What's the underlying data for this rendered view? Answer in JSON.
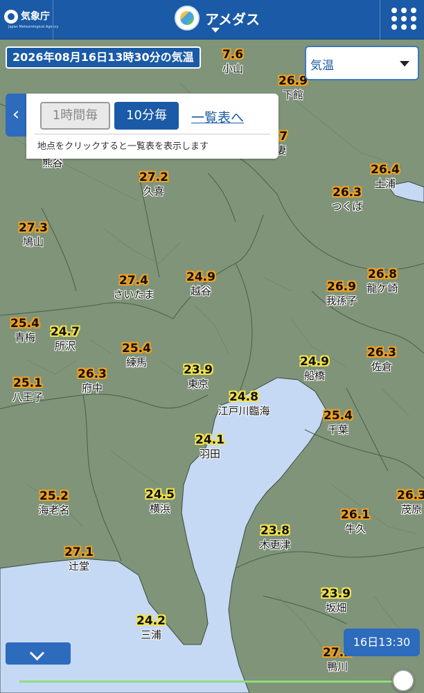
{
  "header": {
    "agency_name": "気象庁",
    "agency_sub": "Japan Meteorological Agency",
    "app_title": "アメダス"
  },
  "datetime_label": "2026年08月16日13時30分の気温",
  "element_select": {
    "value": "気温"
  },
  "panel": {
    "btn_hourly": "1時間毎",
    "btn_10min": "10分毎",
    "list_link": "一覧表へ",
    "hint": "地点をクリックすると一覧表を表示します"
  },
  "stations": [
    {
      "id": "oyama",
      "value": "7.6",
      "name": "小山"
    },
    {
      "id": "shimodate",
      "value": "26.9",
      "name": "下館"
    },
    {
      "id": "koga",
      "value": ".7",
      "name": "妻"
    },
    {
      "id": "kumagaya",
      "value": "",
      "name": "熊谷"
    },
    {
      "id": "kuki",
      "value": "27.2",
      "name": "久喜"
    },
    {
      "id": "tsuchiura",
      "value": "26.4",
      "name": "土浦"
    },
    {
      "id": "tsukuba",
      "value": "26.3",
      "name": "つくば"
    },
    {
      "id": "hatoyama",
      "value": "27.3",
      "name": "鳩山"
    },
    {
      "id": "saitama",
      "value": "27.4",
      "name": "さいたま"
    },
    {
      "id": "koshigaya",
      "value": "24.9",
      "name": "越谷"
    },
    {
      "id": "abiko",
      "value": "26.9",
      "name": "我孫子"
    },
    {
      "id": "ryugasaki",
      "value": "26.8",
      "name": "龍ケ崎"
    },
    {
      "id": "ome",
      "value": "25.4",
      "name": "青梅"
    },
    {
      "id": "tokorozawa",
      "value": "24.7",
      "name": "所沢"
    },
    {
      "id": "nerima",
      "value": "25.4",
      "name": "練馬"
    },
    {
      "id": "funabashi",
      "value": "24.9",
      "name": "船橋"
    },
    {
      "id": "sakura",
      "value": "26.3",
      "name": "佐倉"
    },
    {
      "id": "tokyo",
      "value": "23.9",
      "name": "東京"
    },
    {
      "id": "fuchu",
      "value": "26.3",
      "name": "府中"
    },
    {
      "id": "hachioji",
      "value": "25.1",
      "name": "八王子"
    },
    {
      "id": "edogawa",
      "value": "24.8",
      "name": "江戸川臨海"
    },
    {
      "id": "chiba",
      "value": "25.4",
      "name": "千葉"
    },
    {
      "id": "haneda",
      "value": "24.1",
      "name": "羽田"
    },
    {
      "id": "ebina",
      "value": "25.2",
      "name": "海老名"
    },
    {
      "id": "yokohama",
      "value": "24.5",
      "name": "横浜"
    },
    {
      "id": "mobara",
      "value": "26.3",
      "name": "茂原"
    },
    {
      "id": "ushiku",
      "value": "26.1",
      "name": "牛久"
    },
    {
      "id": "kisarazu",
      "value": "23.8",
      "name": "木更津"
    },
    {
      "id": "tsujido",
      "value": "27.1",
      "name": "辻堂"
    },
    {
      "id": "sakahata",
      "value": "23.9",
      "name": "坂畑"
    },
    {
      "id": "miura",
      "value": "24.2",
      "name": "三浦"
    },
    {
      "id": "kamogawa",
      "value": "27.2",
      "name": "鴨川"
    }
  ],
  "time_badge": "16日13:30",
  "slider": {
    "position": 1.0
  },
  "colors": {
    "header": "#1a5aa6",
    "land": "#7f9479",
    "sea": "#c5d9f5",
    "warm_halo": "#f0a020",
    "cool_halo": "#f2e34a"
  }
}
